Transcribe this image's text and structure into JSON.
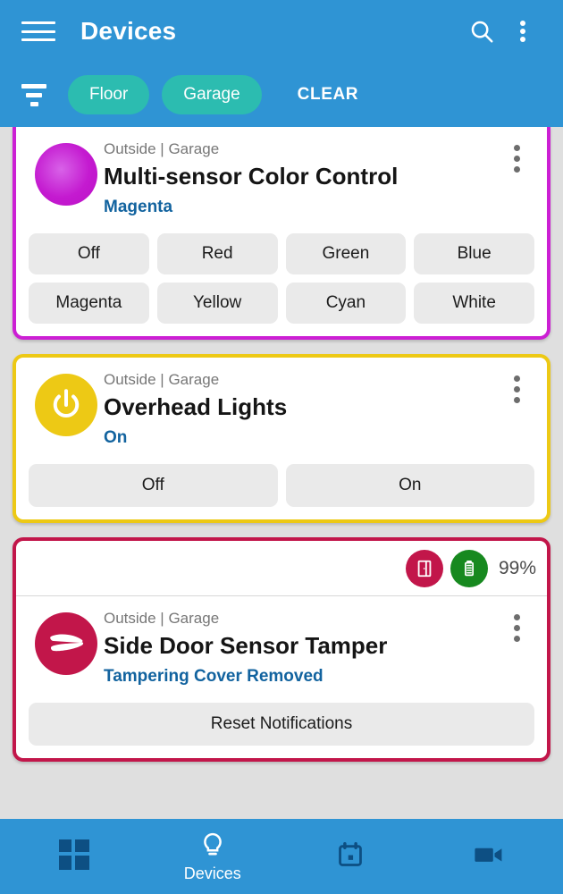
{
  "theme": {
    "appbar_bg": "#2f94d4",
    "chip_bg": "#2cbcb0",
    "page_bg": "#dfdfdf",
    "status_text": "#12639f",
    "nav_icon": "#0d4f83"
  },
  "header": {
    "title": "Devices",
    "menu_icon": "hamburger-icon",
    "search_icon": "search-icon",
    "overflow_icon": "more-vertical-icon",
    "filter_icon": "filter-funnel-icon",
    "chips": [
      {
        "label": "Floor"
      },
      {
        "label": "Garage"
      }
    ],
    "clear_label": "CLEAR"
  },
  "cards": [
    {
      "border_color": "#cc1fd4",
      "room": "Outside | Garage",
      "title": "Multi-sensor Color Control",
      "status": "Magenta",
      "icon": "color-bulb-icon",
      "overflow_icon": "more-vertical-icon",
      "buttons": [
        {
          "label": "Off"
        },
        {
          "label": "Red"
        },
        {
          "label": "Green"
        },
        {
          "label": "Blue"
        },
        {
          "label": "Magenta"
        },
        {
          "label": "Yellow"
        },
        {
          "label": "Cyan"
        },
        {
          "label": "White"
        }
      ]
    },
    {
      "border_color": "#edc915",
      "room": "Outside | Garage",
      "title": "Overhead Lights",
      "status": "On",
      "icon": "power-icon",
      "overflow_icon": "more-vertical-icon",
      "buttons": [
        {
          "label": "Off"
        },
        {
          "label": "On"
        }
      ]
    },
    {
      "border_color": "#c2164a",
      "room": "Outside | Garage",
      "title": "Side Door Sensor Tamper",
      "status": "Tampering Cover Removed",
      "icon": "tamper-clamp-icon",
      "overflow_icon": "more-vertical-icon",
      "badges": {
        "door_icon": "open-door-icon",
        "battery_icon": "battery-full-icon",
        "battery_level": "99%"
      },
      "buttons": [
        {
          "label": "Reset Notifications"
        }
      ]
    }
  ],
  "bottom_nav": [
    {
      "label": "",
      "icon": "dashboard-grid-icon"
    },
    {
      "label": "Devices",
      "icon": "lightbulb-icon"
    },
    {
      "label": "",
      "icon": "calendar-icon"
    },
    {
      "label": "",
      "icon": "video-camera-icon"
    }
  ]
}
